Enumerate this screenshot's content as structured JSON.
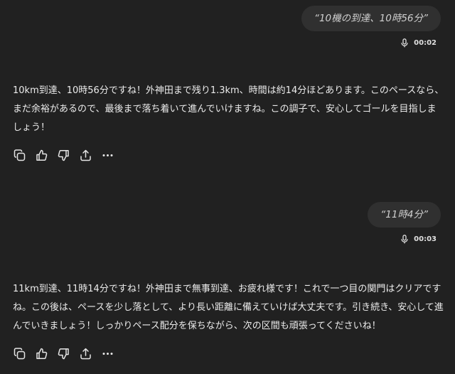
{
  "conversation": {
    "turns": [
      {
        "user": {
          "text": "“10機の到達、10時56分”",
          "voice_icon": "microphone-icon",
          "duration": "00:02"
        },
        "assistant": {
          "text": "10km到達、10時56分ですね！外神田まで残り1.3km、時間は約14分ほどあります。このペースなら、まだ余裕があるので、最後まで落ち着いて進んでいけますね。この調子で、安心してゴールを目指しましょう！"
        }
      },
      {
        "user": {
          "text": "“11時4分”",
          "voice_icon": "microphone-icon",
          "duration": "00:03"
        },
        "assistant": {
          "text": "11km到達、11時14分ですね！外神田まで無事到達、お疲れ様です！これで一つ目の関門はクリアですね。この後は、ペースを少し落として、より長い距離に備えていけば大丈夫です。引き続き、安心して進んでいきましょう！しっかりペース配分を保ちながら、次の区間も頑張ってくださいね！"
        }
      }
    ],
    "action_icons": [
      "copy-icon",
      "thumbs-up-icon",
      "thumbs-down-icon",
      "share-icon",
      "more-icon"
    ]
  },
  "colors": {
    "background": "#212121",
    "bubble": "#303030",
    "text": "#ececec",
    "muted": "#d0d0d0"
  }
}
